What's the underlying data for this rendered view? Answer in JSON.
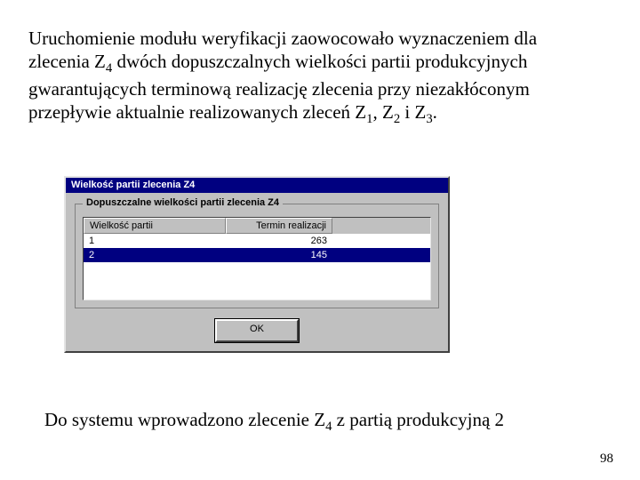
{
  "paragraph": {
    "pre": "Uruchomienie modułu weryfikacji zaowocowało wyznaczeniem dla zlecenia Z",
    "sub1": "4",
    "mid1": " dwóch dopuszczalnych wielkości partii produkcyjnych gwarantujących terminową realizację zlecenia przy niezakłóconym przepływie aktualnie realizowanych zleceń Z",
    "sub2": "1",
    "mid2": ", Z",
    "sub3": "2",
    "mid3": " i Z",
    "sub4": "3",
    "post": "."
  },
  "window": {
    "title": "Wielkość partii zlecenia Z4",
    "group_label": "Dopuszczalne wielkości partii zlecenia Z4",
    "columns": {
      "c1": "Wielkość partii",
      "c2": "Termin realizacji"
    },
    "rows": [
      {
        "batch": "1",
        "term": "263",
        "selected": false
      },
      {
        "batch": "2",
        "term": "145",
        "selected": true
      }
    ],
    "ok_label": "OK"
  },
  "footer": {
    "pre": "Do systemu wprowadzono zlecenie Z",
    "sub": "4",
    "post": " z partią produkcyjną 2"
  },
  "page_number": "98"
}
